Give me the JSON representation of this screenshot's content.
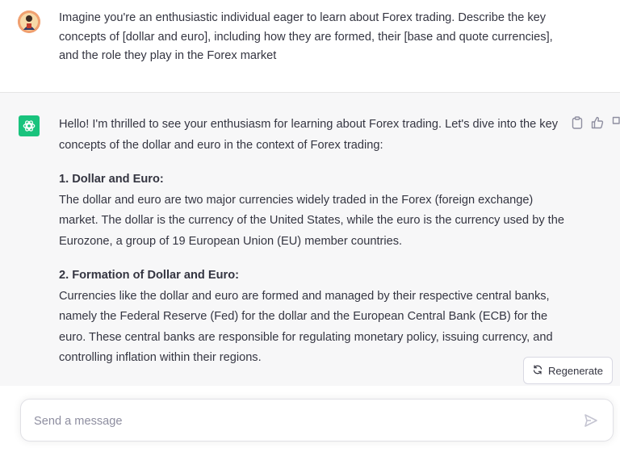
{
  "user_message": {
    "text": "Imagine you're an enthusiastic individual eager to learn about Forex trading. Describe the key concepts of [dollar and euro], including how they are formed, their [base and quote currencies], and the role they play in the Forex market"
  },
  "assistant_message": {
    "intro": "Hello! I'm thrilled to see your enthusiasm for learning about Forex trading. Let's dive into the key concepts of the dollar and euro in the context of Forex trading:",
    "sections": [
      {
        "heading": "1. Dollar and Euro:",
        "body": "The dollar and euro are two major currencies widely traded in the Forex (foreign exchange) market. The dollar is the currency of the United States, while the euro is the currency used by the Eurozone, a group of 19 European Union (EU) member countries."
      },
      {
        "heading": "2. Formation of Dollar and Euro:",
        "body": "Currencies like the dollar and euro are formed and managed by their respective central banks, namely the Federal Reserve (Fed) for the dollar and the European Central Bank (ECB) for the euro. These central banks are responsible for regulating monetary policy, issuing currency, and controlling inflation within their regions."
      }
    ]
  },
  "actions": {
    "copy_icon": "clipboard-icon",
    "like_icon": "thumbs-up-icon",
    "dislike_icon": "thumbs-down-icon"
  },
  "regenerate": {
    "label": "Regenerate",
    "icon": "refresh-icon"
  },
  "composer": {
    "placeholder": "Send a message",
    "send_icon": "send-icon"
  },
  "colors": {
    "brand_green": "#19c37d",
    "assistant_bg": "#f7f7f8",
    "text": "#343541",
    "placeholder": "#8e8ea0"
  }
}
